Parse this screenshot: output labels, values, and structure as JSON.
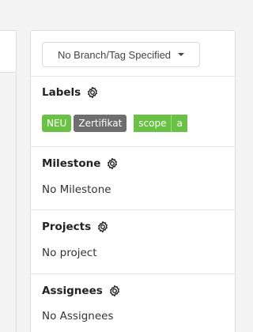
{
  "branch": {
    "label": "No Branch/Tag Specified"
  },
  "labels": {
    "title": "Labels",
    "items": [
      {
        "text": "NEU",
        "color": "#69c243"
      },
      {
        "text": "Zertifikat",
        "color": "#6e6e6e"
      }
    ],
    "scoped": {
      "key": "scope",
      "value": "a",
      "color": "#69c243"
    }
  },
  "milestone": {
    "title": "Milestone",
    "value": "No Milestone"
  },
  "projects": {
    "title": "Projects",
    "value": "No project"
  },
  "assignees": {
    "title": "Assignees",
    "value": "No Assignees"
  }
}
